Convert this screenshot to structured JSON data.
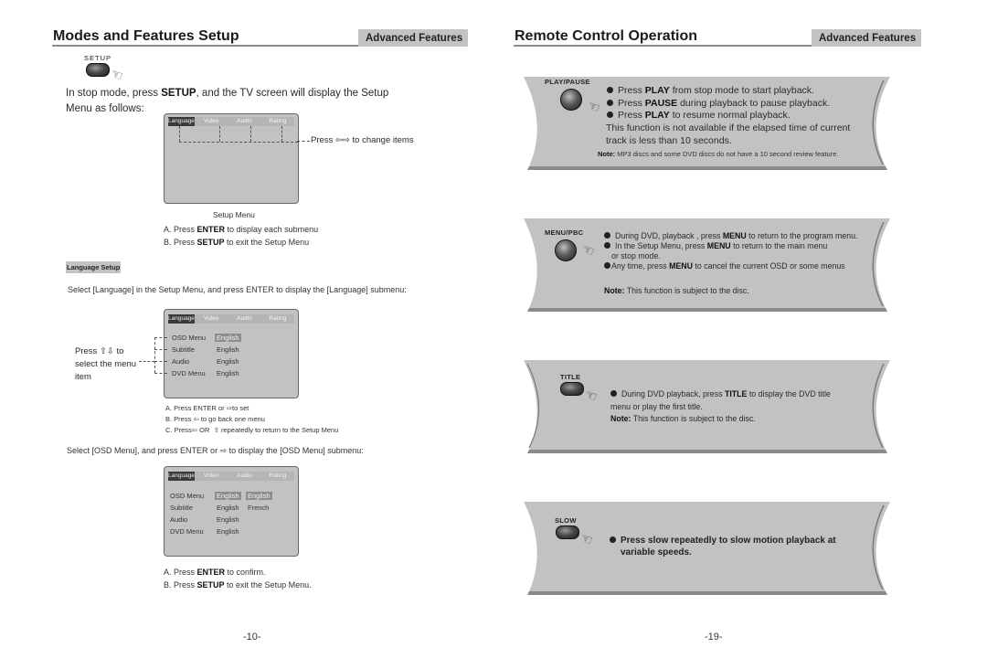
{
  "left_page": {
    "title": "Modes and Features Setup",
    "section_tag": "Advanced Features",
    "setup_button_label": "SETUP",
    "intro_line1_pre": "In stop mode, press ",
    "intro_line1_bold": "SETUP",
    "intro_line1_post": ", and the TV screen will display the Setup",
    "intro_line2": "Menu as follows:",
    "osd_tabs": [
      "Language",
      "Video",
      "Audio",
      "Rating"
    ],
    "setup_menu": {
      "callout_pre": "Press",
      "callout_post": "to change items",
      "caption": "Setup Menu",
      "step_a_pre": "A. Press ",
      "step_a_bold": "ENTER",
      "step_a_post": " to display each submenu",
      "step_b_pre": "B. Press ",
      "step_b_bold": "SETUP",
      "step_b_post": " to exit the Setup Menu"
    },
    "language_setup": {
      "heading": "Language Setup",
      "instruction": "Select [Language] in the Setup Menu, and press ENTER to display the [Language] submenu:",
      "callout_pre": "Press",
      "callout_post": "to",
      "callout_line2": "select the menu",
      "callout_line3": "item",
      "rows": [
        {
          "label": "OSD Menu",
          "value": "English",
          "highlight": true
        },
        {
          "label": "Subtitle",
          "value": "English",
          "highlight": false
        },
        {
          "label": "Audio",
          "value": "English",
          "highlight": false
        },
        {
          "label": "DVD Menu",
          "value": "English",
          "highlight": false
        }
      ],
      "step_a_pre": "A.  Press ENTER or",
      "step_a_post": "to set",
      "step_b_pre": "B.  Press",
      "step_b_post": "to go back one menu",
      "step_c_pre": "C.  Press",
      "step_c_mid": "OR",
      "step_c_post": "repeatedly to return to the Setup Menu"
    },
    "osd_menu": {
      "instruction_pre": "Select [OSD Menu], and press ENTER or",
      "instruction_post": "to display the [OSD Menu] submenu:",
      "rows": [
        {
          "label": "OSD Menu",
          "value": "English",
          "option": "English"
        },
        {
          "label": "Subtitle",
          "value": "English",
          "option": "French"
        },
        {
          "label": "Audio",
          "value": "English",
          "option": ""
        },
        {
          "label": "DVD Menu",
          "value": "English",
          "option": ""
        }
      ],
      "step_a_pre": "A.  Press ",
      "step_a_bold": "ENTER",
      "step_a_post": " to confirm.",
      "step_b_pre": "B.  Press ",
      "step_b_bold": "SETUP",
      "step_b_post": " to exit the Setup Menu."
    },
    "page_number": "-10-"
  },
  "right_page": {
    "title": "Remote Control Operation",
    "section_tag": "Advanced Features",
    "panels": {
      "play_pause": {
        "button_label": "PLAY/PAUSE",
        "line1_pre": "Press ",
        "line1_bold": "PLAY",
        "line1_post": " from stop mode to start playback.",
        "line2_pre": "Press ",
        "line2_bold": "PAUSE",
        "line2_post": " during playback to pause playback.",
        "line3_pre": "Press ",
        "line3_bold": "PLAY",
        "line3_post": " to resume normal playback.",
        "line4": "This function is not available if the elapsed time of current",
        "line5": "track is less than 10 seconds.",
        "note_bold": "Note:",
        "note_text": " MP3 discs and some DVD discs do not have a 10 second review feature."
      },
      "menu_pbc": {
        "button_label": "MENU/PBC",
        "line1_pre": "During DVD, playback , press ",
        "line1_bold": "MENU",
        "line1_post": " to return to the program menu.",
        "line2_pre": "In the Setup Menu, press ",
        "line2_bold": "MENU",
        "line2_post": " to return to the main menu",
        "line2b": "or stop mode.",
        "line3_pre": "Any time, press ",
        "line3_bold": "MENU",
        "line3_post": " to cancel the current OSD or some menus",
        "note_bold": "Note:",
        "note_text": " This function is subject to the disc."
      },
      "title": {
        "button_label": "TITLE",
        "line1_pre": "During DVD playback, press ",
        "line1_bold": "TITLE",
        "line1_post": " to display the DVD title",
        "line2": "menu or play the first title.",
        "note_bold": "Note:",
        "note_text": " This function is subject to the disc."
      },
      "slow": {
        "button_label": "SLOW",
        "line1": "Press slow repeatedly to slow motion playback at",
        "line2": "variable speeds."
      }
    },
    "page_number": "-19-"
  }
}
